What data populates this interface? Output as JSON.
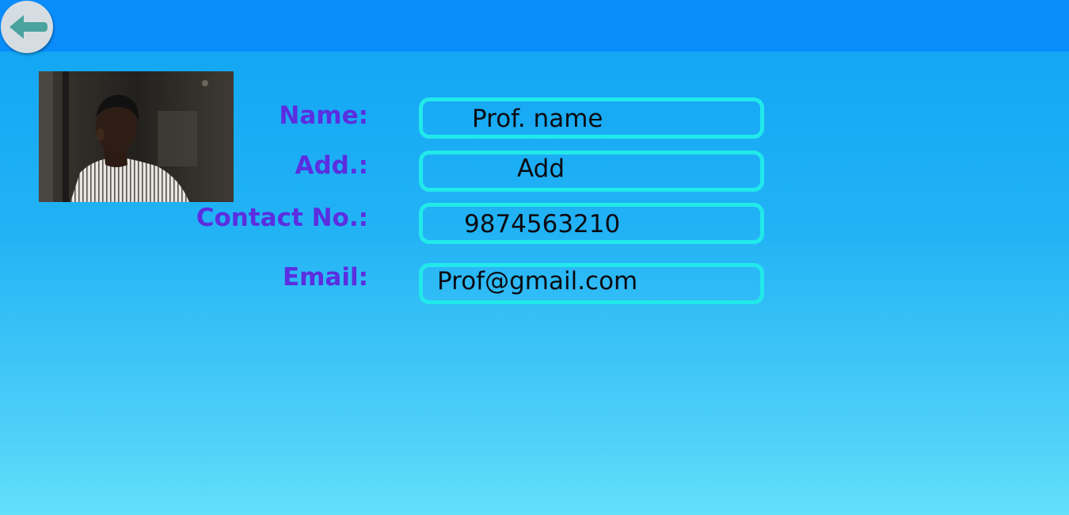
{
  "header": {
    "back_icon": "arrow-left-icon",
    "accent": "#0a8dfb"
  },
  "profile": {
    "photo_description_icon": "profile-photo"
  },
  "form": {
    "name_label": "Name:",
    "name_value": "Prof. name",
    "address_label": "Add.:",
    "address_value": "Add",
    "contact_label": "Contact No.:",
    "contact_value": "9874563210",
    "email_label": "Email:",
    "email_value": "Prof@gmail.com"
  },
  "colors": {
    "label": "#5b2ee0",
    "field_border": "#22e9ea",
    "value_text": "#0b0b12"
  }
}
